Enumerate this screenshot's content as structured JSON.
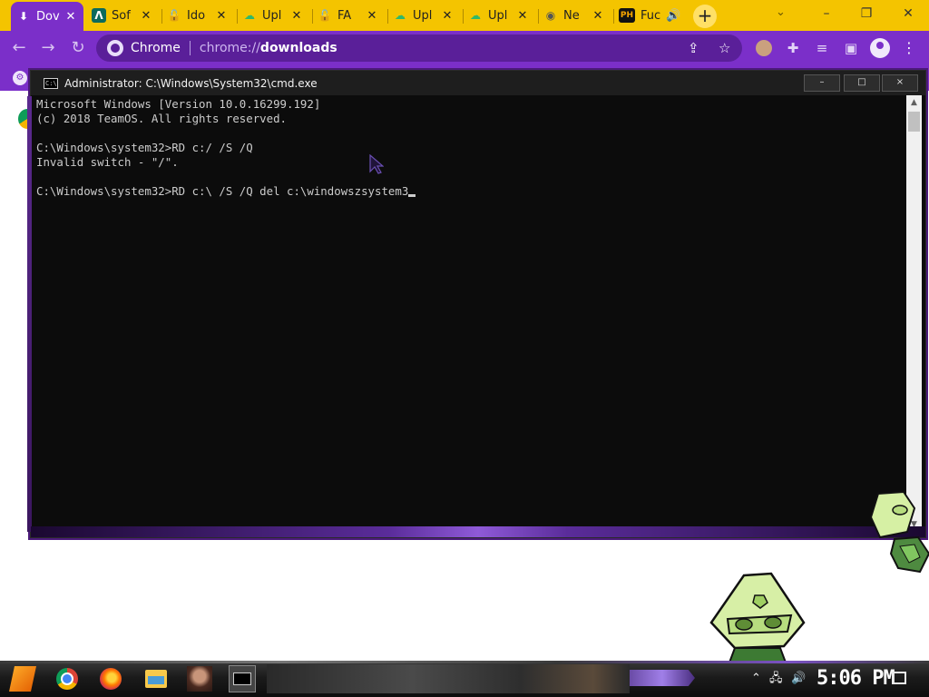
{
  "browser": {
    "tabs": [
      {
        "label": "Dov",
        "icon": "download-icon",
        "active": true
      },
      {
        "label": "Sof",
        "icon": "letter-a-icon"
      },
      {
        "label": "Ido",
        "icon": "red-lock-icon"
      },
      {
        "label": "Upl",
        "icon": "upload-cloud-icon"
      },
      {
        "label": "FA",
        "icon": "red-lock-icon"
      },
      {
        "label": "Upl",
        "icon": "upload-cloud-icon"
      },
      {
        "label": "Upl",
        "icon": "upload-cloud-icon"
      },
      {
        "label": "Ne",
        "icon": "chrome-icon"
      },
      {
        "label": "Fuc",
        "icon": "ph-icon",
        "badge": "PH",
        "audio": true
      }
    ],
    "newtab_label": "+",
    "address": {
      "site_label": "Chrome",
      "scheme": "chrome://",
      "path": "downloads"
    }
  },
  "cmd": {
    "title": "Administrator: C:\\Windows\\System32\\cmd.exe",
    "lines": [
      "Microsoft Windows [Version 10.0.16299.192]",
      "(c) 2018 TeamOS. All rights reserved.",
      "",
      "C:\\Windows\\system32>RD c:/ /S /Q",
      "Invalid switch - \"/\".",
      "",
      "C:\\Windows\\system32>RD c:\\ /S /Q del c:\\windowszsystem3"
    ],
    "buttons": {
      "minimize": "–",
      "maximize": "□",
      "close": "×"
    }
  },
  "taskbar": {
    "clock": "5:06 PM",
    "apps": [
      "chrome-icon",
      "firefox-icon",
      "file-explorer-icon",
      "photo-icon",
      "cmd-icon"
    ]
  },
  "colors": {
    "tabstrip": "#f4c400",
    "toolbar": "#7b2fc9",
    "cmd_bg": "#0c0c0c",
    "cmd_text": "#cccccc"
  }
}
